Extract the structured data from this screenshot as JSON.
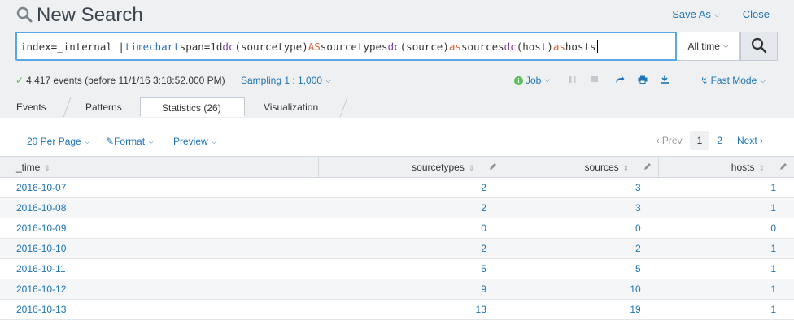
{
  "header": {
    "title": "New Search",
    "save_as": "Save As",
    "close": "Close"
  },
  "search": {
    "query_parts": {
      "p1": "index=_internal | ",
      "p2": "timechart",
      "p3": " span=1d ",
      "p4": "dc",
      "p5": "(sourcetype) ",
      "p6": "AS",
      "p7": " sourcetypes ",
      "p8": "dc",
      "p9": "(source) ",
      "p10": "as",
      "p11": " sources ",
      "p12": "dc",
      "p13": "(host) ",
      "p14": "as",
      "p15": " hosts"
    },
    "time_range": "All time"
  },
  "status": {
    "events_text": "4,417 events (before 11/1/16 3:18:52.000 PM)",
    "sampling": "Sampling 1 : 1,000",
    "job": "Job",
    "mode": "Fast Mode"
  },
  "tabs": [
    "Events",
    "Patterns",
    "Statistics (26)",
    "Visualization"
  ],
  "toolbar": {
    "per_page": "20 Per Page",
    "format": "Format",
    "preview": "Preview"
  },
  "pager": {
    "prev": "‹ Prev",
    "page1": "1",
    "page2": "2",
    "next": "Next ›"
  },
  "table": {
    "columns": [
      "_time",
      "sourcetypes",
      "sources",
      "hosts"
    ],
    "rows": [
      [
        "2016-10-07",
        "2",
        "3",
        "1"
      ],
      [
        "2016-10-08",
        "2",
        "3",
        "1"
      ],
      [
        "2016-10-09",
        "0",
        "0",
        "0"
      ],
      [
        "2016-10-10",
        "2",
        "2",
        "1"
      ],
      [
        "2016-10-11",
        "5",
        "5",
        "1"
      ],
      [
        "2016-10-12",
        "9",
        "10",
        "1"
      ],
      [
        "2016-10-13",
        "13",
        "19",
        "1"
      ]
    ]
  },
  "colors": {
    "accent": "#1e74b5",
    "success": "#5cc05c",
    "search_border": "#5aa7e8"
  }
}
